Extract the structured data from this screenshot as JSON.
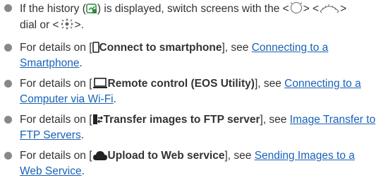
{
  "items": [
    {
      "part1": "If the history (",
      "history_icon": "history-icon",
      "part2": ") is displayed, switch screens with the <",
      "dial1_icon": "quick-control-dial-icon",
      "part3": "> <",
      "dial2_icon": "main-dial-icon",
      "part4": ">",
      "line2_part1": "dial or <",
      "multi_icon": "multi-controller-icon",
      "line2_part2": ">."
    },
    {
      "prefix": "For details on [",
      "icon": "smartphone-icon",
      "bold": "Connect to smartphone",
      "middle": "], see ",
      "link": "Connecting to a Smartphone",
      "suffix": "."
    },
    {
      "prefix": "For details on [",
      "icon": "computer-icon",
      "bold": "Remote control (EOS Utility)",
      "middle": "], see ",
      "link": "Connecting to a Computer via Wi-Fi",
      "suffix": "."
    },
    {
      "prefix": "For details on [",
      "icon": "ftp-transfer-icon",
      "bold": "Transfer images to FTP server",
      "middle": "], see ",
      "link": "Image Transfer to FTP Servers",
      "suffix": "."
    },
    {
      "prefix": "For details on [",
      "icon": "cloud-upload-icon",
      "bold": "Upload to Web service",
      "middle": "], see ",
      "link": "Sending Images to a Web Service",
      "suffix": "."
    }
  ],
  "colors": {
    "text": "#333333",
    "link": "#1a62b8",
    "bullet": "#888888",
    "icon_accent": "#2a8a3c"
  }
}
